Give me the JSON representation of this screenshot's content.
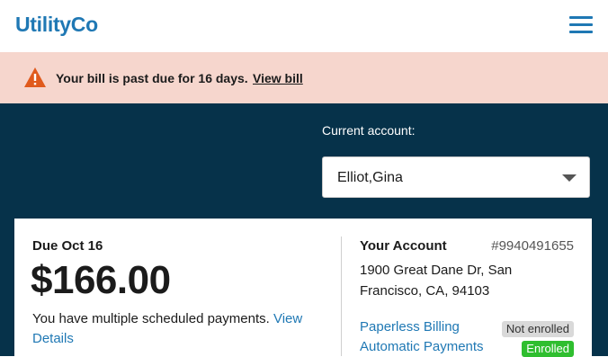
{
  "header": {
    "brand": "UtilityCo",
    "menu_icon": "hamburger-menu-icon"
  },
  "alert": {
    "icon": "warning-triangle-icon",
    "icon_color": "#e05a1c",
    "message": "Your bill is past due for 16 days.",
    "link_label": "View bill"
  },
  "account_selector": {
    "label": "Current account:",
    "value": "Elliot,Gina"
  },
  "bill": {
    "due_label": "Due Oct 16",
    "amount": "$166.00",
    "scheduled_text": "You have multiple scheduled payments.",
    "details_link": "View Details"
  },
  "account": {
    "title": "Your Account",
    "number": "#9940491655",
    "address": "1900 Great Dane Dr, San Francisco, CA, 94103",
    "services": [
      {
        "label": "Paperless Billing",
        "status": "Not enrolled"
      },
      {
        "label": "Automatic Payments",
        "status": "Enrolled"
      }
    ]
  },
  "colors": {
    "brand": "#1f78b4",
    "hero_bg": "#06324a",
    "alert_bg": "#f6d6cd",
    "enrolled": "#2fbe2f",
    "not_enrolled": "#d9d9d9"
  }
}
